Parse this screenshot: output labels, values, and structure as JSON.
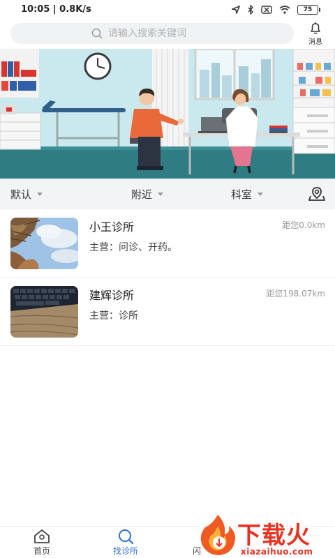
{
  "status_bar": {
    "time": "10:05 | 0.8K/s",
    "battery": "75"
  },
  "search": {
    "placeholder": "请输入搜索关键词"
  },
  "header": {
    "message_label": "消息"
  },
  "filters": [
    {
      "label": "默认"
    },
    {
      "label": "附近"
    },
    {
      "label": "科室"
    }
  ],
  "clinics": [
    {
      "name": "小王诊所",
      "distance": "距您0.0km",
      "main": "主营：问诊、开药。",
      "thumb": "tree-photo"
    },
    {
      "name": "建辉诊所",
      "distance": "距您198.07km",
      "main": "主营：诊所",
      "thumb": "keyboard-photo"
    }
  ],
  "nav": [
    {
      "label": "首页",
      "icon": "home-icon"
    },
    {
      "label": "找诊所",
      "icon": "search-icon",
      "active": true
    },
    {
      "label": "闪",
      "icon": "flash-icon"
    }
  ],
  "watermark": {
    "title": "下载火",
    "subtitle": "xiazaihuo.com"
  },
  "colors": {
    "accent": "#2f6fd8",
    "watermark": "#e8321f",
    "filter_bg": "#f3f4f6"
  }
}
